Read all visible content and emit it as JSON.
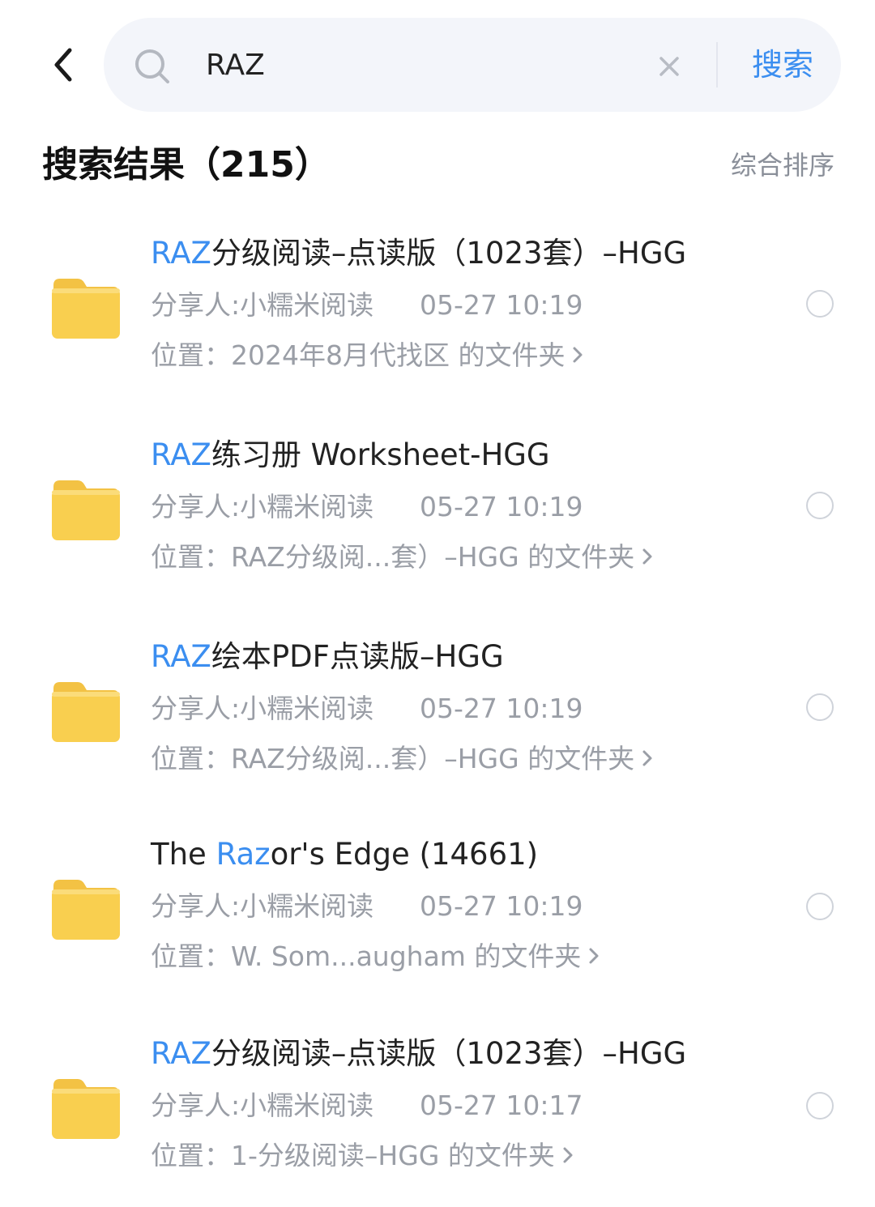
{
  "search": {
    "back_icon": "chevron-left-icon",
    "search_icon": "magnifier-icon",
    "query": "RAZ",
    "clear_icon": "close-icon",
    "submit_label": "搜索"
  },
  "results": {
    "title": "搜索结果（215）",
    "sort_label": "综合排序",
    "items": [
      {
        "name_prefix": "",
        "name_highlight": "RAZ",
        "name_suffix": "分级阅读–点读版（1023套）–HGG",
        "sharer": "分享人:小糯米阅读",
        "time": "05-27 10:19",
        "location": "位置：2024年8月代找区 的文件夹"
      },
      {
        "name_prefix": "",
        "name_highlight": "RAZ",
        "name_suffix": "练习册 Worksheet-HGG",
        "sharer": "分享人:小糯米阅读",
        "time": "05-27 10:19",
        "location": "位置：RAZ分级阅...套）–HGG 的文件夹"
      },
      {
        "name_prefix": "",
        "name_highlight": "RAZ",
        "name_suffix": "绘本PDF点读版–HGG",
        "sharer": "分享人:小糯米阅读",
        "time": "05-27 10:19",
        "location": "位置：RAZ分级阅...套）–HGG 的文件夹"
      },
      {
        "name_prefix": "The ",
        "name_highlight": "Raz",
        "name_suffix": "or's Edge (14661)",
        "sharer": "分享人:小糯米阅读",
        "time": "05-27 10:19",
        "location": "位置：W. Som...augham 的文件夹"
      },
      {
        "name_prefix": "",
        "name_highlight": "RAZ",
        "name_suffix": "分级阅读–点读版（1023套）–HGG",
        "sharer": "分享人:小糯米阅读",
        "time": "05-27 10:17",
        "location": "位置：1-分级阅读–HGG 的文件夹"
      }
    ]
  },
  "icons": {
    "folder": "folder-icon",
    "radio": "select-circle-icon",
    "location_chevron": "chevron-right-icon"
  },
  "colors": {
    "accent": "#3b8ef0",
    "folder": "#f9cf4f",
    "secondary_text": "#9a9ea6",
    "search_bg": "#f3f5fa"
  }
}
